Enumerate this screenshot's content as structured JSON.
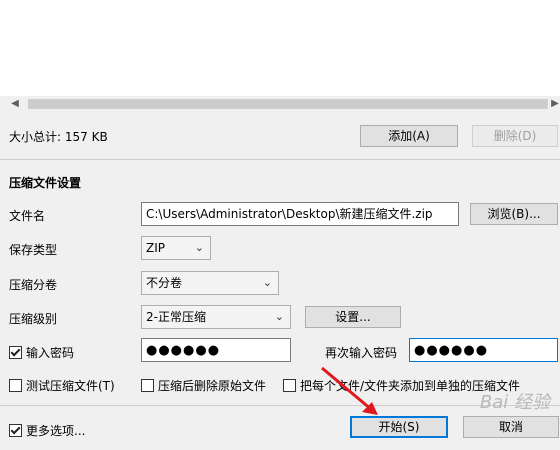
{
  "size_total": "大小总计: 157 KB",
  "buttons": {
    "add": "添加(A)",
    "delete": "删除(D)",
    "browse": "浏览(B)...",
    "settings": "设置...",
    "start": "开始(S)",
    "cancel": "取消"
  },
  "section_title": "压缩文件设置",
  "labels": {
    "filename": "文件名",
    "save_type": "保存类型",
    "split": "压缩分卷",
    "level": "压缩级别",
    "enter_password": "输入密码",
    "reenter_password": "再次输入密码",
    "test_archive": "测试压缩文件(T)",
    "delete_after": "压缩后删除原始文件",
    "each_separate": "把每个文件/文件夹添加到单独的压缩文件",
    "more_options": "更多选项..."
  },
  "fields": {
    "filename": "C:\\Users\\Administrator\\Desktop\\新建压缩文件.zip",
    "save_type": "ZIP",
    "split": "不分卷",
    "level": "2-正常压缩",
    "password_mask": "●●●●●●",
    "reenter_mask": "●●●●●●"
  },
  "checks": {
    "enter_password": true,
    "test_archive": false,
    "delete_after": false,
    "each_separate": false,
    "more_options": true
  },
  "icons": {
    "scroll_left": "◀",
    "scroll_right": "▶",
    "chevron": "⌄"
  },
  "annotation": {
    "arrow_color": "#e0191e"
  },
  "watermark": "Bai 经验"
}
